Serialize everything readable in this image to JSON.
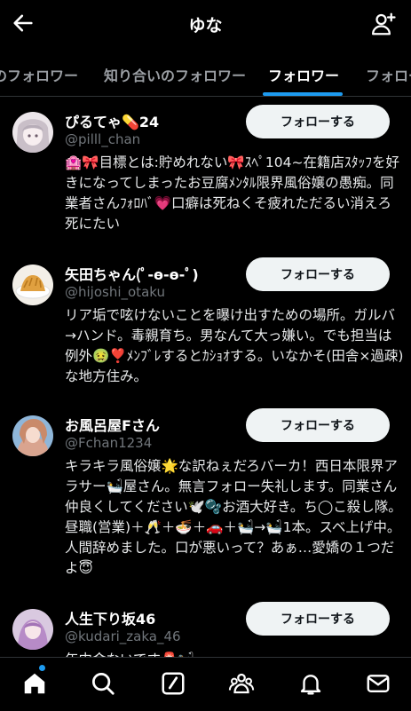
{
  "header": {
    "title": "ゆな"
  },
  "tabs": [
    {
      "label": "のフォロワー"
    },
    {
      "label": "知り合いのフォロワー"
    },
    {
      "label": "フォロワー"
    },
    {
      "label": "フォロー中"
    }
  ],
  "follow_label": "フォローする",
  "users": [
    {
      "name": "ぴるてゃ💊24",
      "handle": "@pilll_chan",
      "bio": "🏩🎀目標とは:貯めれない🎀ｽﾍﾟ104~在籍店ｽﾀｯﾌを好きになってしまったお豆腐ﾒﾝﾀﾙ限界風俗嬢の愚痴。同業者さんﾌｫﾛﾊﾞ💗口癖は死ねくそ疲れただるい消えろ死にたい"
    },
    {
      "name": "矢田ちゃん(ﾟ-ө-ө-ﾟ)",
      "handle": "@hijoshi_otaku",
      "bio": "リア垢で呟けないことを曝け出すための場所。ガルバ→ハンド。毒親育ち。男なんて大っ嫌い。でも担当は例外🤢❣️ﾒﾝﾌﾞﾚするとｶｼｮｵする。いなかそ(田舎×過疎)な地方住み。"
    },
    {
      "name": "お風呂屋Fさん",
      "handle": "@Fchan1234",
      "bio": "キラキラ風俗嬢🌟な訳ねぇだろバーカ！西日本限界アラサー🛀屋さん。無言フォロー失礼します。同業さん仲良くしてください🕊️🫧お酒大好き。ち◯こ殺し隊。昼職(営業)＋🥂＋🍜＋🚗＋🛀→🛀1本。スベ上げ中。人間辞めました。口が悪いって？あぁ…愛嬌の１つだよ😇"
    },
    {
      "name": "人生下り坂46",
      "handle": "@kudari_zaka_46",
      "bio": "年中金ないです🚨🛀"
    }
  ],
  "icons": {
    "back": "arrow-left-icon",
    "add_follow": "person-add-icon",
    "nav": [
      "home-icon",
      "search-icon",
      "compose-icon",
      "communities-icon",
      "notifications-icon",
      "messages-icon"
    ]
  },
  "colors": {
    "accent": "#1d9bf0",
    "background": "#000000",
    "button": "#eff3f4",
    "muted": "#71767b"
  }
}
